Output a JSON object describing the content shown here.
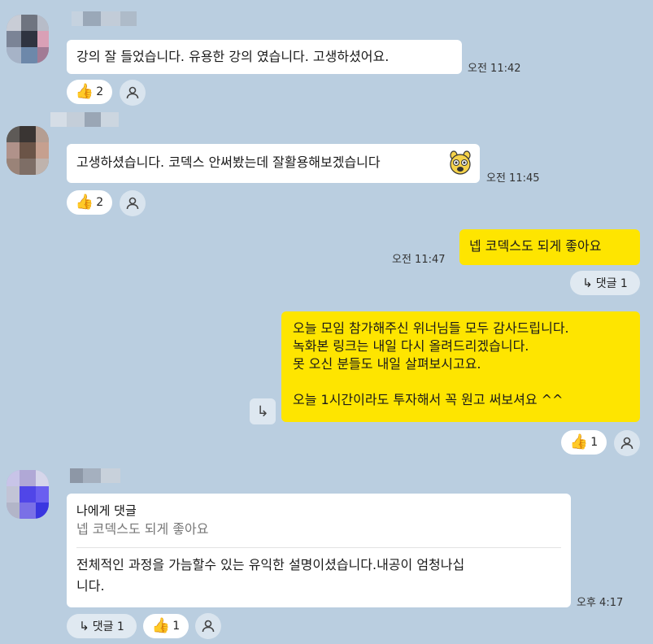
{
  "messages": [
    {
      "text": "강의 잘 들었습니다. 유용한 강의 였습니다. 고생하셨어요.",
      "time": "오전 11:42",
      "like_count": "2"
    },
    {
      "text": "고생하셨습니다. 코덱스 안써봤는데 잘활용해보겠습니다",
      "time": "오전 11:45",
      "like_count": "2"
    },
    {
      "text": "넵 코덱스도 되게 좋아요",
      "time": "오전 11:47",
      "reply_label": "댓글 1"
    },
    {
      "lines": [
        "오늘 모임 참가해주신 위너님들 모두 감사드립니다.",
        "녹화본 링크는 내일 다시 올려드리겠습니다.",
        "못 오신 분들도 내일 살펴보시고요.",
        "",
        "오늘 1시간이라도 투자해서 꼭 원고 써보셔요 ^^"
      ],
      "like_count": "1"
    },
    {
      "quote_title": "나에게 댓글",
      "quote_text": "넵 코덱스도 되게 좋아요",
      "lines": [
        "전체적인 과정을 가늠할수 있는 유익한 설명이셨습니다.내공이 엄청나십",
        "니다."
      ],
      "time": "오후 4:17",
      "reply_label": "댓글 1",
      "like_count": "1"
    }
  ],
  "colors": {
    "background": "#bacee0",
    "my_bubble": "#fee500",
    "other_bubble": "#ffffff"
  }
}
